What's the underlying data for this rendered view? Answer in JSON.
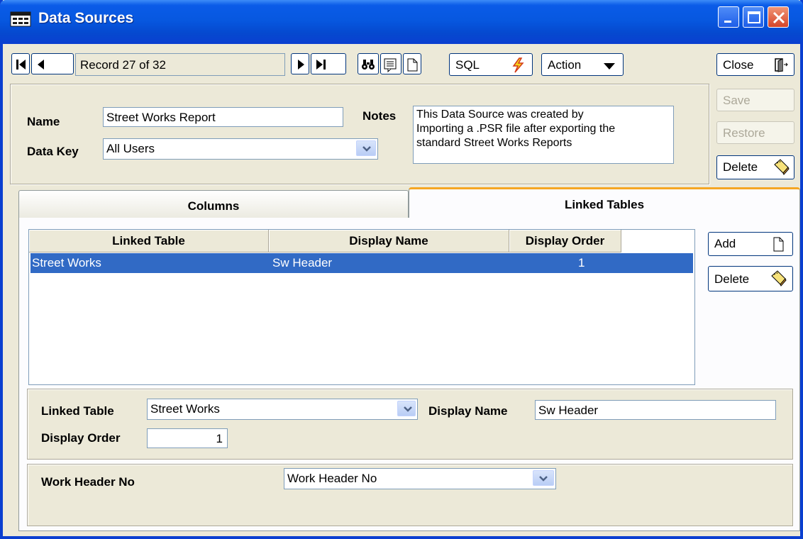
{
  "window": {
    "title": "Data Sources",
    "accent": "#0a3fd0"
  },
  "toolbar": {
    "record_text": "Record 27 of 32",
    "sql_label": "SQL",
    "action_label": "Action",
    "close_label": "Close",
    "save_label": "Save",
    "restore_label": "Restore",
    "delete_label": "Delete"
  },
  "form": {
    "name_label": "Name",
    "name_value": "Street Works Report",
    "datakey_label": "Data Key",
    "datakey_value": "All Users",
    "notes_label": "Notes",
    "notes_line1": "This Data Source was created by",
    "notes_line2": "Importing a .PSR file after exporting the",
    "notes_line3": "standard Street Works Reports"
  },
  "tabs": [
    {
      "label": "Columns",
      "active": false
    },
    {
      "label": "Linked Tables",
      "active": true
    }
  ],
  "grid": {
    "columns": [
      "Linked Table",
      "Display Name",
      "Display Order"
    ],
    "rows": [
      {
        "linked_table": "Street Works",
        "display_name": "Sw Header",
        "display_order": "1"
      }
    ],
    "selected_color": "#316ac5"
  },
  "side_buttons": {
    "add_label": "Add",
    "delete_label": "Delete"
  },
  "detail": {
    "linked_table_label": "Linked Table",
    "linked_table_value": "Street Works",
    "display_name_label": "Display Name",
    "display_name_value": "Sw Header",
    "display_order_label": "Display Order",
    "display_order_value": "1"
  },
  "join": {
    "field_label": "Work Header No",
    "field_value": "Work Header No"
  }
}
